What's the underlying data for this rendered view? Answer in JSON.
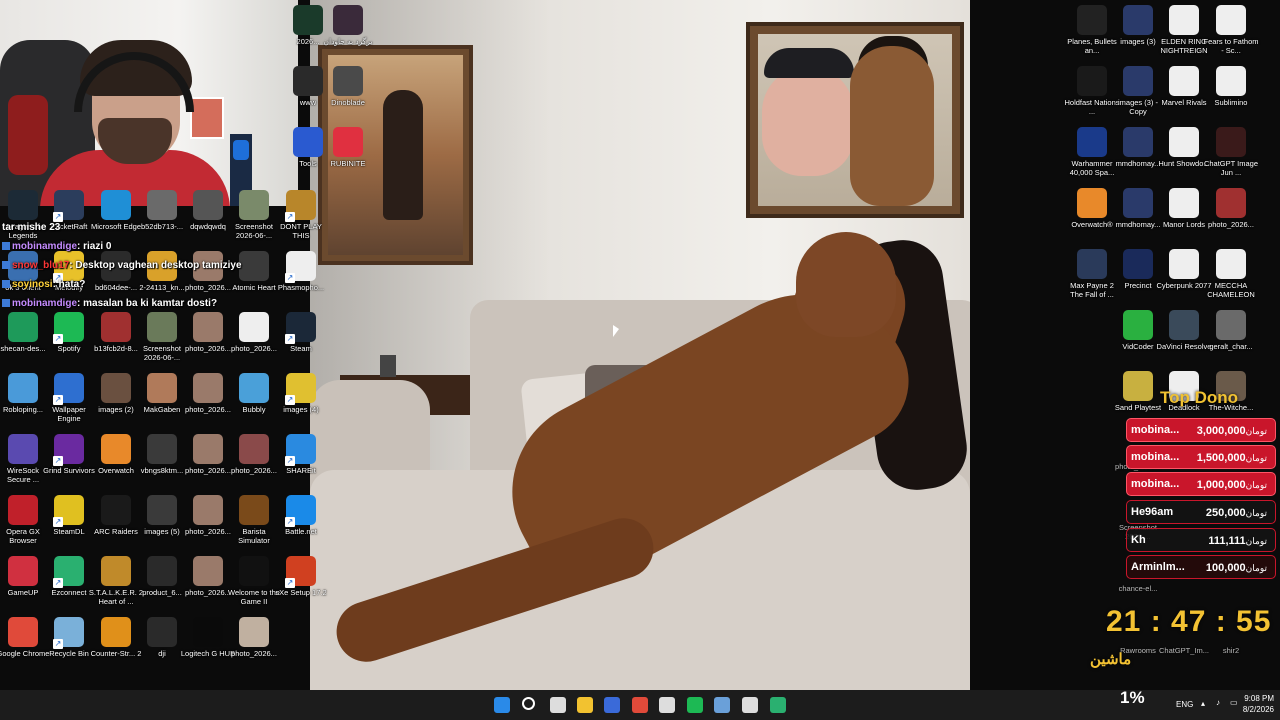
{
  "stream": {
    "chat": [
      {
        "user": "tar mishe 23",
        "text": "",
        "user_color": "white"
      },
      {
        "user": "mobinamdige",
        "text": ": riazi 0",
        "user_color": "purple"
      },
      {
        "user": "snow_blu17",
        "text": ": Desktop vaghean desktop tamiziye",
        "user_color": "red"
      },
      {
        "user": "soyinosi",
        "text": ": hata?",
        "user_color": "yellow"
      },
      {
        "user": "mobinamdige",
        "text": ": masalan ba ki kamtar dosti?",
        "user_color": "purple"
      }
    ],
    "top_dono": {
      "title": "Top Dono",
      "currency": "تومان",
      "rows": [
        {
          "name": "mobina...",
          "amount": "3,000,000"
        },
        {
          "name": "mobina...",
          "amount": "1,500,000"
        },
        {
          "name": "mobina...",
          "amount": "1,000,000"
        },
        {
          "name": "He96am",
          "amount": "250,000"
        },
        {
          "name": "Kh",
          "amount": "111,111"
        },
        {
          "name": "Arminlm...",
          "amount": "100,000"
        }
      ]
    },
    "clock_overlay": "21 : 47 : 55",
    "clock_label": "ماشین"
  },
  "desktop": {
    "left_icons": [
      {
        "label": "League of Legends",
        "color": "#1c2a36"
      },
      {
        "label": "PacketRaft",
        "color": "#2b3d5c"
      },
      {
        "label": "Microsoft Edge",
        "color": "#1f8fd6"
      },
      {
        "label": "b52db713-...",
        "color": "#6a6a6a"
      },
      {
        "label": "dqwdqwdq",
        "color": "#555"
      },
      {
        "label": "Screenshot 2026-06-...",
        "color": "#7a8a6a"
      },
      {
        "label": "DONT PLAY THIS",
        "color": "#b8862a"
      },
      {
        "label": "ok 3 Client",
        "color": "#3a6fb0"
      },
      {
        "label": "Melodify",
        "color": "#e8c12a"
      },
      {
        "label": "bd604dee-...",
        "color": "#2b2b2b"
      },
      {
        "label": "2-24113_kn...",
        "color": "#d9a12a"
      },
      {
        "label": "photo_2026...",
        "color": "#9a7a6a"
      },
      {
        "label": "Atomic Heart",
        "color": "#3a3a3a"
      },
      {
        "label": "Phasmopho...",
        "color": "#eeeeee"
      },
      {
        "label": "shecan-des...",
        "color": "#1e9a5a"
      },
      {
        "label": "Spotify",
        "color": "#1db954"
      },
      {
        "label": "b13fcb2d-8...",
        "color": "#a03030"
      },
      {
        "label": "Screenshot 2026-06-...",
        "color": "#6a7a5a"
      },
      {
        "label": "photo_2026...",
        "color": "#9a7a6a"
      },
      {
        "label": "photo_2026...",
        "color": "#eeeeee"
      },
      {
        "label": "Steam",
        "color": "#1b2838"
      },
      {
        "label": "Robloping...",
        "color": "#4a9ad9"
      },
      {
        "label": "Wallpaper Engine",
        "color": "#2e6fd0"
      },
      {
        "label": "images (2)",
        "color": "#6a5040"
      },
      {
        "label": "MakGaben",
        "color": "#b07a5a"
      },
      {
        "label": "photo_2026...",
        "color": "#9a7a6a"
      },
      {
        "label": "Bubbly",
        "color": "#4aa0d9"
      },
      {
        "label": "images (4)",
        "color": "#e0c030"
      },
      {
        "label": "WireSock Secure ...",
        "color": "#5a4ab0"
      },
      {
        "label": "Grind Survivors",
        "color": "#6a2aa0"
      },
      {
        "label": "Overwatch",
        "color": "#e8892a"
      },
      {
        "label": "vbngs8ktm...",
        "color": "#3a3a3a"
      },
      {
        "label": "photo_2026...",
        "color": "#9a7a6a"
      },
      {
        "label": "photo_2026...",
        "color": "#8a4a4a"
      },
      {
        "label": "SHAREit",
        "color": "#2a8ae0"
      },
      {
        "label": "Opera GX Browser",
        "color": "#c0202a"
      },
      {
        "label": "SteamDL",
        "color": "#e0c020"
      },
      {
        "label": "ARC Raiders",
        "color": "#1a1a1a"
      },
      {
        "label": "images (5)",
        "color": "#3a3a3a"
      },
      {
        "label": "photo_2026...",
        "color": "#9a7a6a"
      },
      {
        "label": "Barista Simulator",
        "color": "#7a4a1a"
      },
      {
        "label": "Battle.net",
        "color": "#1a8ae8"
      },
      {
        "label": "GameUP",
        "color": "#d03040"
      },
      {
        "label": "Ezconnect",
        "color": "#2ab070"
      },
      {
        "label": "S.T.A.L.K.E.R. 2 Heart of ...",
        "color": "#c08a2a"
      },
      {
        "label": "product_6...",
        "color": "#2a2a2a"
      },
      {
        "label": "photo_2026...",
        "color": "#9a7a6a"
      },
      {
        "label": "Welcome to the Game II",
        "color": "#111111"
      },
      {
        "label": "sXe Setup 17.2",
        "color": "#d04020"
      },
      {
        "label": "Google Chrome",
        "color": "#e04a3a"
      },
      {
        "label": "Recycle Bin",
        "color": "#7ab0d9"
      },
      {
        "label": "Counter-Str... 2",
        "color": "#e0901a"
      },
      {
        "label": "dji",
        "color": "#2a2a2a"
      },
      {
        "label": "Logitech G HUB",
        "color": "#0a0a0a"
      },
      {
        "label": "photo_2026...",
        "color": "#c0b0a0"
      }
    ],
    "column_strip": [
      {
        "label": "2026...",
        "color": "#1a3a2a"
      },
      {
        "label": "www",
        "color": "#2a2a2a"
      },
      {
        "label": "Tools",
        "color": "#2a5ad0"
      }
    ],
    "top_icons": [
      {
        "label": "برگرد به جاودان",
        "color": "#3a2a3a"
      },
      {
        "label": "Dinoblade",
        "color": "#4a4a4a"
      },
      {
        "label": "RUBINITE",
        "color": "#e03040"
      }
    ],
    "right_icons": [
      {
        "label": "Planes, Bullets an...",
        "color": "#222"
      },
      {
        "label": "images (3)",
        "color": "#2a3a6a"
      },
      {
        "label": "ELDEN RING NIGHTREIGN",
        "color": "#eeeeee"
      },
      {
        "label": "Fears to Fathom - Sc...",
        "color": "#eeeeee"
      },
      {
        "label": "Holdfast Nations ...",
        "color": "#1a1a1a"
      },
      {
        "label": "images (3) - Copy",
        "color": "#2a3a6a"
      },
      {
        "label": "Marvel Rivals",
        "color": "#eeeeee"
      },
      {
        "label": "Sublimino",
        "color": "#eeeeee"
      },
      {
        "label": "Warhammer 40,000 Spa...",
        "color": "#1a3a8a"
      },
      {
        "label": "mmdhomay...",
        "color": "#2a3a6a"
      },
      {
        "label": "Hunt Showdo...",
        "color": "#eeeeee"
      },
      {
        "label": "ChatGPT Image Jun ...",
        "color": "#3a1a1a"
      },
      {
        "label": "Overwatch®",
        "color": "#e8892a"
      },
      {
        "label": "mmdhomay...",
        "color": "#2a3a6a"
      },
      {
        "label": "Manor Lords",
        "color": "#eeeeee"
      },
      {
        "label": "photo_2026...",
        "color": "#a03030"
      },
      {
        "label": "Max Payne 2 The Fall of ...",
        "color": "#2a3a5a"
      },
      {
        "label": "Precinct",
        "color": "#1a2a5a"
      },
      {
        "label": "Cyberpunk 2077",
        "color": "#eeeeee"
      },
      {
        "label": "MECCHA CHAMELEON",
        "color": "#eeeeee"
      },
      {
        "label": "VidCoder",
        "color": "#2ab040"
      },
      {
        "label": "DaVinci Resolve",
        "color": "#3a4a5a"
      },
      {
        "label": "geralt_char...",
        "color": "#6a6a6a"
      },
      {
        "label": "Sand Playtest",
        "color": "#c8b040"
      },
      {
        "label": "Deadlock",
        "color": "#eeeeee"
      },
      {
        "label": "The-Witche...",
        "color": "#6a5a4a"
      }
    ],
    "under_dono_labels": [
      "photo_2026...",
      "Screenshot 2026-...",
      "chance-el...",
      "Rawrooms",
      "ChatGPT_Im...",
      "shir2"
    ]
  },
  "taskbar": {
    "apps": [
      {
        "name": "windows-start-icon",
        "color": "#2a8ae8"
      },
      {
        "name": "search-icon",
        "color": "#ffffff"
      },
      {
        "name": "task-view-icon",
        "color": "#dddddd"
      },
      {
        "name": "file-explorer-icon",
        "color": "#f2c230"
      },
      {
        "name": "vpn-app-icon",
        "color": "#3a6ad9"
      },
      {
        "name": "chrome-icon",
        "color": "#e04a3a"
      },
      {
        "name": "logitech-icon",
        "color": "#dddddd"
      },
      {
        "name": "spotify-icon",
        "color": "#1db954"
      },
      {
        "name": "steam-icon",
        "color": "#6aa0d9"
      },
      {
        "name": "github-icon",
        "color": "#dddddd"
      },
      {
        "name": "app-green-icon",
        "color": "#2ab070"
      }
    ],
    "battery": "1%",
    "language": "ENG",
    "time": "9:08 PM",
    "date": "8/2/2026"
  }
}
